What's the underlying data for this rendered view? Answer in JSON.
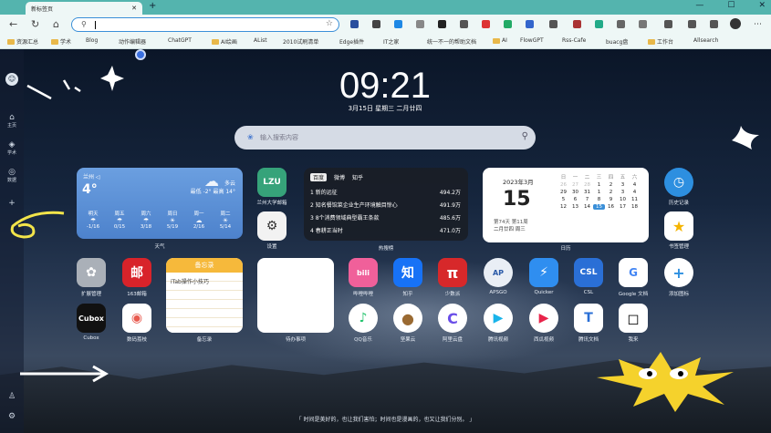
{
  "browser": {
    "tab_title": "新标签页",
    "new_tab": "+",
    "window_controls": [
      "—",
      "☐",
      "✕"
    ],
    "address": "",
    "bookmarks": [
      "资源汇总",
      "学术",
      "Blog",
      "动作编辑器",
      "ChatGPT",
      "AI绘画",
      "AList",
      "2010试刷清单",
      "Edge插件",
      "IT之家",
      "统一不一的帮助文档",
      "AI",
      "FlowGPT",
      "Rss-Cafe",
      "buacg盘",
      "工作台",
      "Allsearch"
    ]
  },
  "sidebar": {
    "items": [
      {
        "label": "主页"
      },
      {
        "label": "学术"
      },
      {
        "label": "数据"
      }
    ]
  },
  "clock": {
    "time": "09:21",
    "date": "3月15日  星期三  二月廿四"
  },
  "search": {
    "placeholder": "输入搜索内容"
  },
  "weather": {
    "city": "兰州 ◁",
    "temp": "4°",
    "condition": "多云",
    "range": "最低 -2° 最高 14°",
    "forecast": [
      {
        "day": "明天",
        "temp": "-1/16"
      },
      {
        "day": "周五",
        "temp": "0/15"
      },
      {
        "day": "周六",
        "temp": "3/18"
      },
      {
        "day": "周日",
        "temp": "5/19"
      },
      {
        "day": "周一",
        "temp": "2/16"
      },
      {
        "day": "周二",
        "temp": "5/14"
      }
    ],
    "label": "天气"
  },
  "hot": {
    "tabs": [
      "百度",
      "微博",
      "知乎"
    ],
    "items": [
      {
        "title": "1 新的远征",
        "value": "494.2万"
      },
      {
        "title": "2 知名餐馆菜企业生产环境触目惊心",
        "value": "491.9万"
      },
      {
        "title": "3 8个消费领域典型霸王条款",
        "value": "485.6万"
      },
      {
        "title": "4 春耕正当时",
        "value": "471.0万"
      }
    ],
    "label": "热搜榜"
  },
  "calendar": {
    "ym": "2023年3月",
    "day": "15",
    "sub1": "第74天 第11周",
    "sub2": "二月廿四 周三",
    "head": [
      "日",
      "一",
      "二",
      "三",
      "四",
      "五",
      "六"
    ],
    "days": [
      "26",
      "27",
      "28",
      "1",
      "2",
      "3",
      "4",
      "29",
      "30",
      "31",
      "1",
      "2",
      "3",
      "4",
      "5",
      "6",
      "7",
      "8",
      "9",
      "10",
      "11",
      "12",
      "13",
      "14",
      "15",
      "16",
      "17",
      "18",
      "19",
      "20",
      "21",
      "22",
      "23",
      "24",
      "25",
      "26",
      "27",
      "28",
      "29",
      "30",
      "31",
      "1",
      "2",
      "3",
      "4",
      "5",
      "6",
      "7",
      "8"
    ],
    "label": "日历"
  },
  "widgets": {
    "memo_title": "备忘录",
    "memo_item": "iTab操作小技巧",
    "memo_label": "备忘录",
    "todo_label": "待办事项"
  },
  "apps": [
    {
      "name": "兰州大学邮箱",
      "glyph": "LZU"
    },
    {
      "name": "设置",
      "glyph": "⚙"
    },
    {
      "name": "历史记录",
      "glyph": "◷"
    },
    {
      "name": "书签管理",
      "glyph": "★"
    },
    {
      "name": "扩展管理",
      "glyph": "✿"
    },
    {
      "name": "163邮箱",
      "glyph": "邮"
    },
    {
      "name": "哔哩哔哩",
      "glyph": "bili"
    },
    {
      "name": "知乎",
      "glyph": "知"
    },
    {
      "name": "少数派",
      "glyph": "π"
    },
    {
      "name": "APSGO",
      "glyph": "AP"
    },
    {
      "name": "Quicker",
      "glyph": "⚡"
    },
    {
      "name": "CSL",
      "glyph": "CSL"
    },
    {
      "name": "Google 文档",
      "glyph": "G"
    },
    {
      "name": "添加图标",
      "glyph": "+"
    },
    {
      "name": "Cubox",
      "glyph": "Cubox"
    },
    {
      "name": "数码荔枝",
      "glyph": "◉"
    },
    {
      "name": "QQ音乐",
      "glyph": "♪"
    },
    {
      "name": "坚果云",
      "glyph": "●"
    },
    {
      "name": "阿里云盘",
      "glyph": "C"
    },
    {
      "name": "腾讯视频",
      "glyph": "▶"
    },
    {
      "name": "西瓜视频",
      "glyph": "▶"
    },
    {
      "name": "腾讯文档",
      "glyph": "T"
    },
    {
      "name": "我来",
      "glyph": "◻"
    }
  ],
  "quote": "「 时间是美好的，也让我们害怕；时间也是漫画的，也又让我们分别。 」",
  "colors": {
    "tabstrip": "#54b4ae",
    "accent": "#3a8fd8",
    "weather": "#5b8fd6"
  }
}
